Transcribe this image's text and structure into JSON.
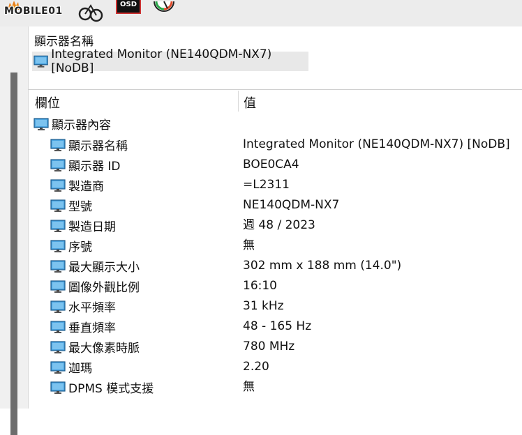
{
  "toolbar": {
    "logo_text": "MOBILE01",
    "osd_label": "OSD"
  },
  "device": {
    "header": "顯示器名稱",
    "name": "Integrated Monitor (NE140QDM-NX7) [NoDB]"
  },
  "columns": {
    "field": "欄位",
    "value": "值"
  },
  "group": {
    "label": "顯示器內容"
  },
  "rows": [
    {
      "label": "顯示器名稱",
      "value": "Integrated Monitor (NE140QDM-NX7) [NoDB]"
    },
    {
      "label": "顯示器 ID",
      "value": "BOE0CA4"
    },
    {
      "label": "製造商",
      "value": "=L2311"
    },
    {
      "label": "型號",
      "value": "NE140QDM-NX7"
    },
    {
      "label": "製造日期",
      "value": "週 48 / 2023"
    },
    {
      "label": "序號",
      "value": "無"
    },
    {
      "label": "最大顯示大小",
      "value": "302 mm x 188 mm (14.0\")"
    },
    {
      "label": "圖像外觀比例",
      "value": "16:10"
    },
    {
      "label": "水平頻率",
      "value": "31 kHz"
    },
    {
      "label": "垂直頻率",
      "value": "48 - 165 Hz"
    },
    {
      "label": "最大像素時脈",
      "value": "780 MHz"
    },
    {
      "label": "迦瑪",
      "value": "2.20"
    },
    {
      "label": "DPMS 模式支援",
      "value": "無"
    }
  ]
}
